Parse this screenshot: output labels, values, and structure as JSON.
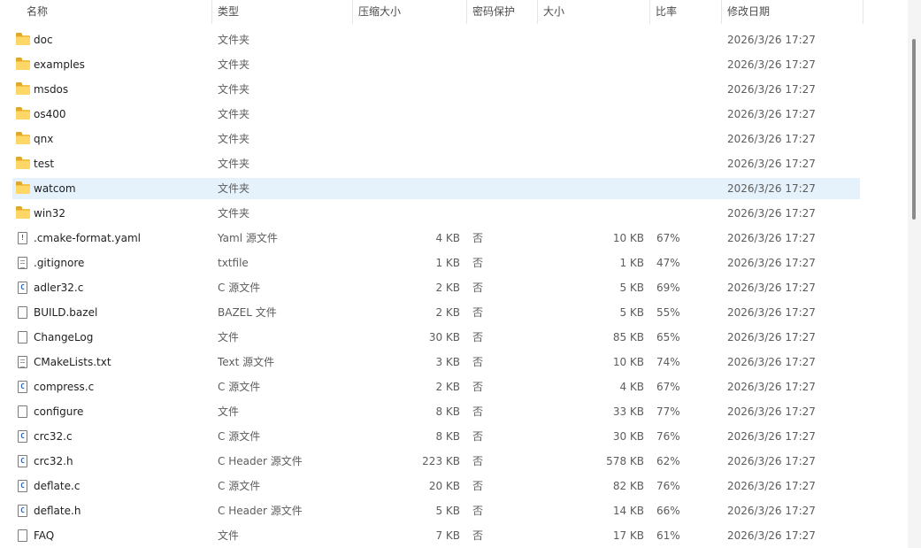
{
  "columns": {
    "name": "名称",
    "type": "类型",
    "compressed": "压缩大小",
    "password": "密码保护",
    "size": "大小",
    "ratio": "比率",
    "modified": "修改日期",
    "sort_indicator": "^"
  },
  "rows": [
    {
      "icon": "folder-icon",
      "name": "doc",
      "type": "文件夹",
      "compressed": "",
      "password": "",
      "size": "",
      "ratio": "",
      "modified": "2026/3/26 17:27"
    },
    {
      "icon": "folder-icon",
      "name": "examples",
      "type": "文件夹",
      "compressed": "",
      "password": "",
      "size": "",
      "ratio": "",
      "modified": "2026/3/26 17:27"
    },
    {
      "icon": "folder-icon",
      "name": "msdos",
      "type": "文件夹",
      "compressed": "",
      "password": "",
      "size": "",
      "ratio": "",
      "modified": "2026/3/26 17:27"
    },
    {
      "icon": "folder-icon",
      "name": "os400",
      "type": "文件夹",
      "compressed": "",
      "password": "",
      "size": "",
      "ratio": "",
      "modified": "2026/3/26 17:27"
    },
    {
      "icon": "folder-icon",
      "name": "qnx",
      "type": "文件夹",
      "compressed": "",
      "password": "",
      "size": "",
      "ratio": "",
      "modified": "2026/3/26 17:27"
    },
    {
      "icon": "folder-icon",
      "name": "test",
      "type": "文件夹",
      "compressed": "",
      "password": "",
      "size": "",
      "ratio": "",
      "modified": "2026/3/26 17:27"
    },
    {
      "icon": "folder-icon",
      "name": "watcom",
      "type": "文件夹",
      "compressed": "",
      "password": "",
      "size": "",
      "ratio": "",
      "modified": "2026/3/26 17:27",
      "selected": true
    },
    {
      "icon": "folder-icon",
      "name": "win32",
      "type": "文件夹",
      "compressed": "",
      "password": "",
      "size": "",
      "ratio": "",
      "modified": "2026/3/26 17:27"
    },
    {
      "icon": "yaml-file-icon",
      "glyph": "!",
      "name": ".cmake-format.yaml",
      "type": "Yaml 源文件",
      "compressed": "4 KB",
      "password": "否",
      "size": "10 KB",
      "ratio": "67%",
      "modified": "2026/3/26 17:27"
    },
    {
      "icon": "text-file-icon",
      "glyph": "",
      "name": ".gitignore",
      "type": "txtfile",
      "compressed": "1 KB",
      "password": "否",
      "size": "1 KB",
      "ratio": "47%",
      "modified": "2026/3/26 17:27"
    },
    {
      "icon": "c-file-icon",
      "glyph": "C",
      "name": "adler32.c",
      "type": "C 源文件",
      "compressed": "2 KB",
      "password": "否",
      "size": "5 KB",
      "ratio": "69%",
      "modified": "2026/3/26 17:27"
    },
    {
      "icon": "blank-file-icon",
      "glyph": "",
      "name": "BUILD.bazel",
      "type": "BAZEL 文件",
      "compressed": "2 KB",
      "password": "否",
      "size": "5 KB",
      "ratio": "55%",
      "modified": "2026/3/26 17:27"
    },
    {
      "icon": "blank-file-icon",
      "glyph": "",
      "name": "ChangeLog",
      "type": "文件",
      "compressed": "30 KB",
      "password": "否",
      "size": "85 KB",
      "ratio": "65%",
      "modified": "2026/3/26 17:27"
    },
    {
      "icon": "text-file-icon",
      "glyph": "",
      "name": "CMakeLists.txt",
      "type": "Text 源文件",
      "compressed": "3 KB",
      "password": "否",
      "size": "10 KB",
      "ratio": "74%",
      "modified": "2026/3/26 17:27"
    },
    {
      "icon": "c-file-icon",
      "glyph": "C",
      "name": "compress.c",
      "type": "C 源文件",
      "compressed": "2 KB",
      "password": "否",
      "size": "4 KB",
      "ratio": "67%",
      "modified": "2026/3/26 17:27"
    },
    {
      "icon": "blank-file-icon",
      "glyph": "",
      "name": "configure",
      "type": "文件",
      "compressed": "8 KB",
      "password": "否",
      "size": "33 KB",
      "ratio": "77%",
      "modified": "2026/3/26 17:27"
    },
    {
      "icon": "c-file-icon",
      "glyph": "C",
      "name": "crc32.c",
      "type": "C 源文件",
      "compressed": "8 KB",
      "password": "否",
      "size": "30 KB",
      "ratio": "76%",
      "modified": "2026/3/26 17:27"
    },
    {
      "icon": "c-file-icon",
      "glyph": "C",
      "name": "crc32.h",
      "type": "C Header 源文件",
      "compressed": "223 KB",
      "password": "否",
      "size": "578 KB",
      "ratio": "62%",
      "modified": "2026/3/26 17:27"
    },
    {
      "icon": "c-file-icon",
      "glyph": "C",
      "name": "deflate.c",
      "type": "C 源文件",
      "compressed": "20 KB",
      "password": "否",
      "size": "82 KB",
      "ratio": "76%",
      "modified": "2026/3/26 17:27"
    },
    {
      "icon": "c-file-icon",
      "glyph": "C",
      "name": "deflate.h",
      "type": "C Header 源文件",
      "compressed": "5 KB",
      "password": "否",
      "size": "14 KB",
      "ratio": "66%",
      "modified": "2026/3/26 17:27"
    },
    {
      "icon": "blank-file-icon",
      "glyph": "",
      "name": "FAQ",
      "type": "文件",
      "compressed": "7 KB",
      "password": "否",
      "size": "17 KB",
      "ratio": "61%",
      "modified": "2026/3/26 17:27"
    }
  ]
}
